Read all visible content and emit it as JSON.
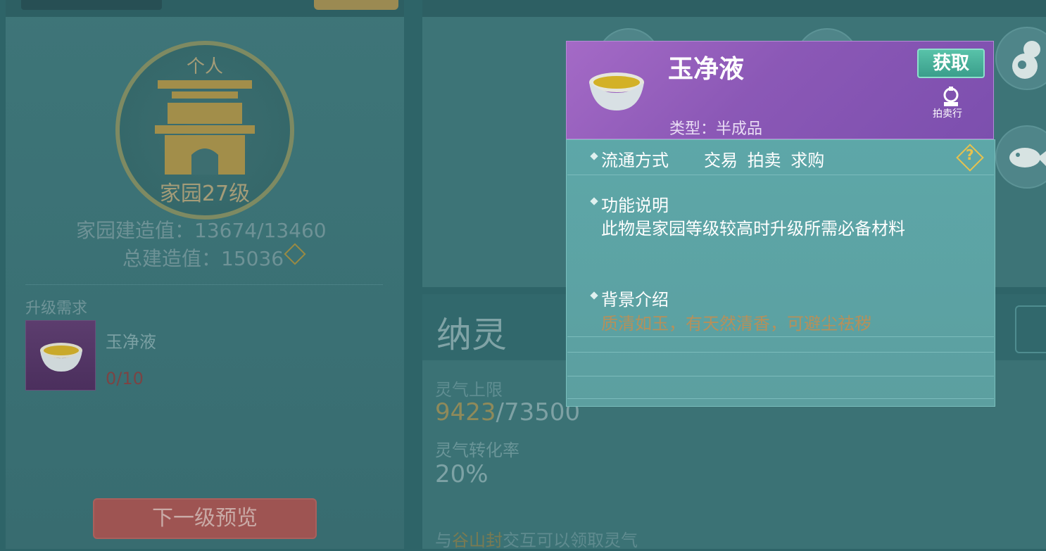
{
  "home": {
    "emblem_label": "个人",
    "level_label": "家园27级",
    "build_value_label": "家园建造值：13674/13460",
    "total_build_label": "总建造值：15036",
    "upgrade_req_title": "升级需求",
    "req_item_name": "玉净液",
    "req_item_count": "0/10",
    "next_level_button": "下一级预览"
  },
  "nalin": {
    "title": "纳灵",
    "lingqi_limit_label": "灵气上限",
    "lingqi_current": "9423",
    "lingqi_max": "/73500",
    "conversion_label": "灵气转化率",
    "conversion_value": "20%",
    "note_prefix": "与",
    "note_highlight": "谷山封",
    "note_suffix": "交互可以领取灵气"
  },
  "popup": {
    "item_name": "玉净液",
    "item_type": "类型：半成品",
    "get_button": "获取",
    "auction_label": "拍卖行",
    "circulation_label": "流通方式",
    "circulation_value": "交易 拍卖 求购",
    "function_title": "功能说明",
    "function_text": "此物是家园等级较高时升级所需必备材料",
    "background_title": "背景介绍",
    "background_text": "质清如玉，有天然清香，可避尘祛秽"
  },
  "colors": {
    "popup_header": "#8b58b6",
    "popup_body": "#5da7a8",
    "get_button": "#3a9e8b",
    "background_text": "#b6905a",
    "help_icon": "#e7c24e"
  },
  "icons": [
    "bowl-icon",
    "auction-house-icon",
    "help-diamond-icon",
    "house-gate-icon",
    "fish-icon",
    "gourd-icon"
  ]
}
